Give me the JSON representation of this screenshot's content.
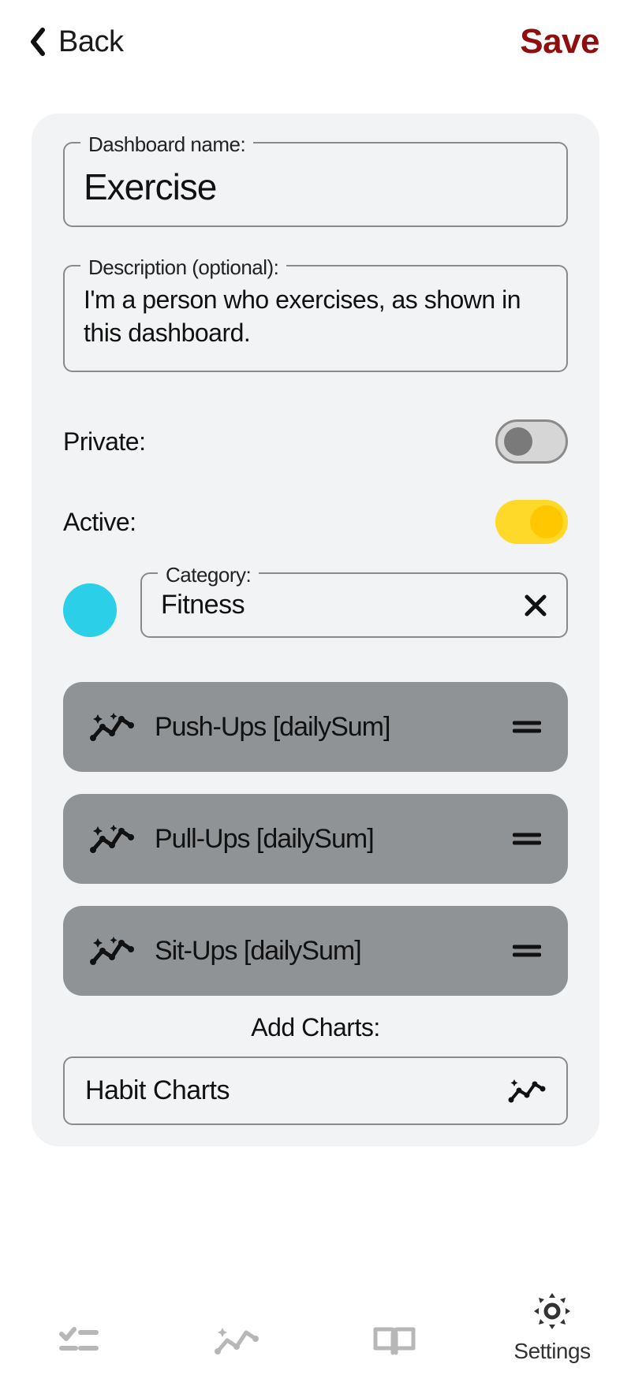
{
  "header": {
    "back_label": "Back",
    "save_label": "Save"
  },
  "form": {
    "name_label": "Dashboard name:",
    "name_value": "Exercise",
    "desc_label": "Description (optional):",
    "desc_value": "I'm a person who exercises, as shown in this dashboard.",
    "private_label": "Private:",
    "private_on": false,
    "active_label": "Active:",
    "active_on": true,
    "category_label": "Category:",
    "category_value": "Fitness",
    "category_color": "#2bcfe8"
  },
  "charts": [
    {
      "label": "Push-Ups [dailySum]"
    },
    {
      "label": "Pull-Ups [dailySum]"
    },
    {
      "label": "Sit-Ups [dailySum]"
    }
  ],
  "add_section": {
    "title": "Add Charts:",
    "row_label": "Habit Charts"
  },
  "nav": {
    "settings_label": "Settings"
  }
}
